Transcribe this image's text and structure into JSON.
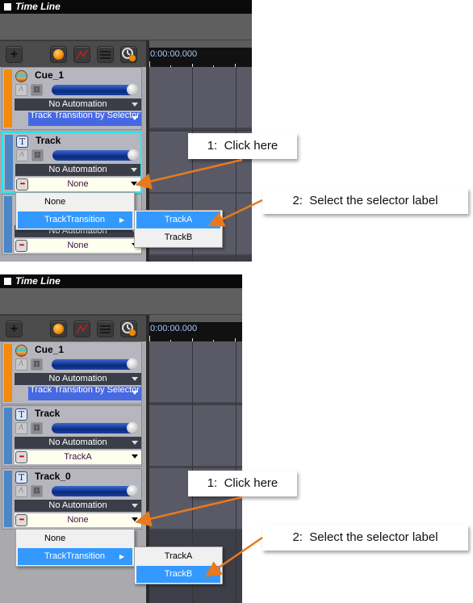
{
  "window_title": "Time Line",
  "toolbar": {
    "icons": [
      "add-icon",
      "record-ball-icon",
      "automation-graph-icon",
      "list-icon",
      "clock-icon"
    ],
    "add_label": "+"
  },
  "ruler_time": "0:00:00.000",
  "colors": {
    "highlight": "#3399ff",
    "cue_bar": "#f58a0b",
    "track_bar": "#4a86c8",
    "selected_border": "#27e6f0",
    "arrow": "#e87a1c",
    "selector_blue": "#4668e2"
  },
  "steps": [
    {
      "tracks": [
        {
          "name": "Cue_1",
          "type": "cue",
          "automation": "No Automation",
          "selector": "Track Transition by Selector"
        },
        {
          "name": "Track",
          "type": "track",
          "selected": true,
          "automation": "No Automation",
          "selector": "None"
        },
        {
          "name": "",
          "type": "track",
          "automation": "No Automation",
          "selector": "None"
        }
      ],
      "menu": {
        "items": [
          "None",
          "TrackTransition"
        ],
        "submenu": [
          "TrackA",
          "TrackB"
        ],
        "highlighted_sub": "TrackA"
      },
      "callout1": "1:  Click here",
      "callout2": "2:  Select the selector label"
    },
    {
      "tracks": [
        {
          "name": "Cue_1",
          "type": "cue",
          "automation": "No Automation",
          "selector": "Track Transition by Selector"
        },
        {
          "name": "Track",
          "type": "track",
          "automation": "No Automation",
          "selector": "TrackA"
        },
        {
          "name": "Track_0",
          "type": "track",
          "automation": "No Automation",
          "selector": "None"
        }
      ],
      "menu": {
        "items": [
          "None",
          "TrackTransition"
        ],
        "submenu": [
          "TrackA",
          "TrackB"
        ],
        "highlighted_sub": "TrackB"
      },
      "callout1": "1:  Click here",
      "callout2": "2:  Select the selector label"
    }
  ]
}
